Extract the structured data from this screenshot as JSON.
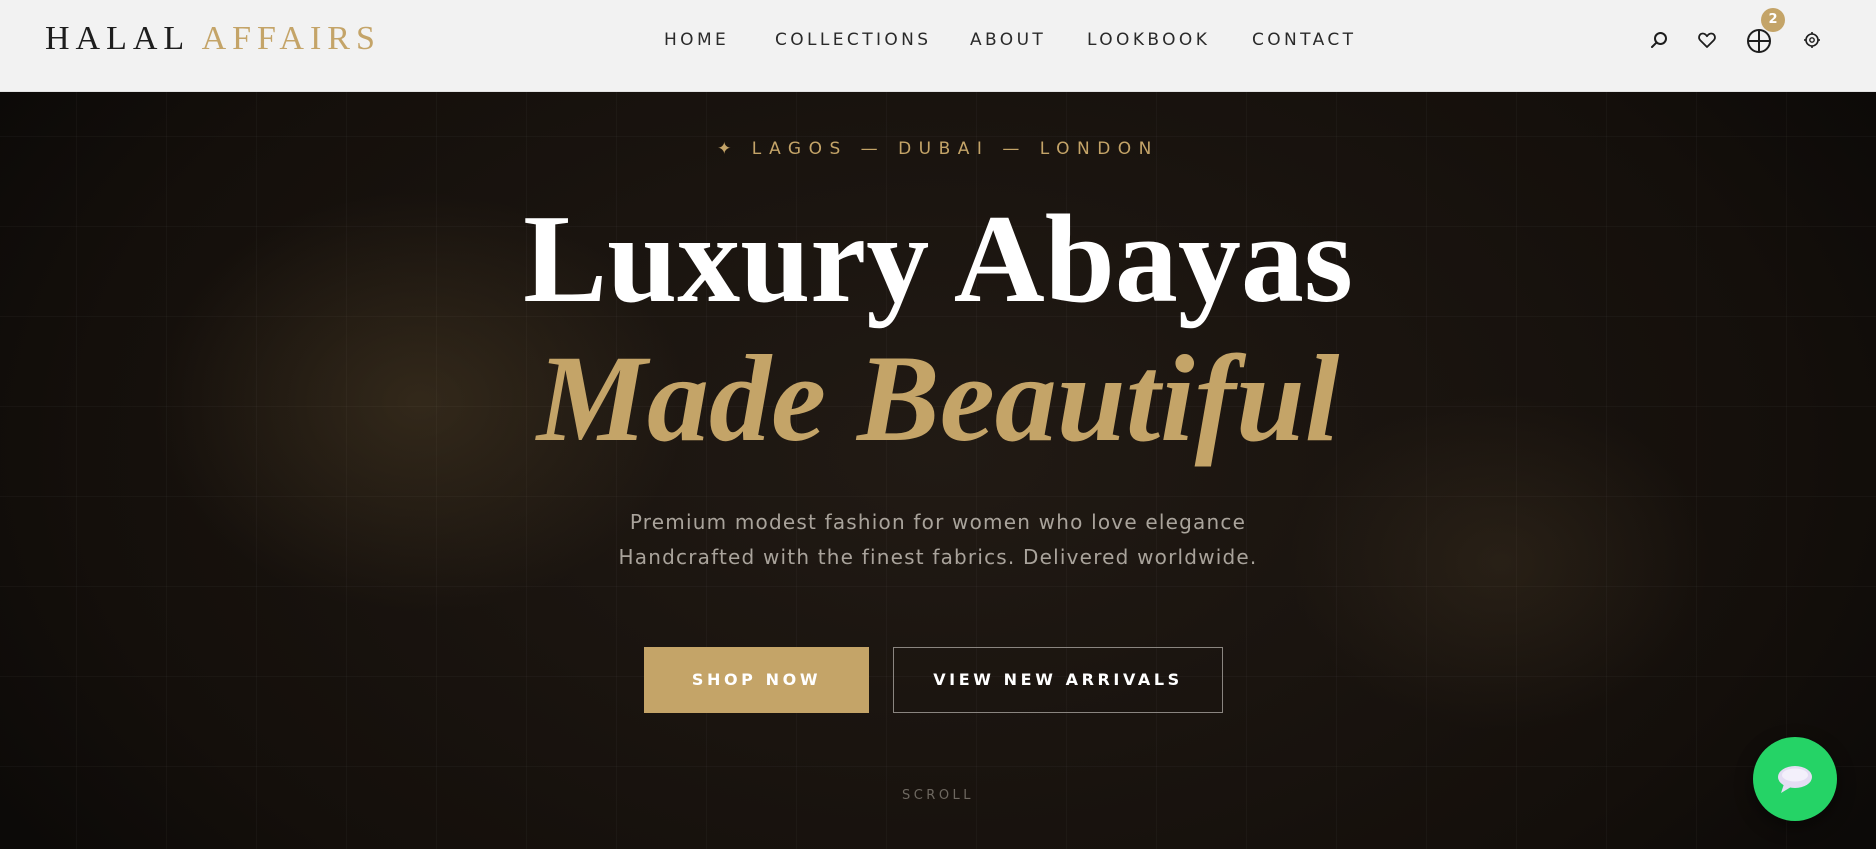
{
  "brand": {
    "name_primary": "HALAL",
    "name_accent": "AFFAIRS"
  },
  "nav": {
    "items": [
      {
        "label": "HOME"
      },
      {
        "label": "COLLECTIONS"
      },
      {
        "label": "ABOUT"
      },
      {
        "label": "LOOKBOOK"
      },
      {
        "label": "CONTACT"
      }
    ]
  },
  "header_icons": {
    "search": "search-icon",
    "wishlist": "heart-icon",
    "cart": "cart-icon",
    "cart_count": "2",
    "account": "user-icon"
  },
  "hero": {
    "tagline": "✦ LAGOS — DUBAI — LONDON",
    "headline_line1": "Luxury Abayas",
    "headline_line2": "Made Beautiful",
    "subtitle_line1": "Premium modest fashion for women who love elegance",
    "subtitle_line2": "Handcrafted with the finest fabrics. Delivered worldwide.",
    "primary_cta": "SHOP NOW",
    "secondary_cta": "VIEW NEW ARRIVALS",
    "scroll_hint": "SCROLL"
  },
  "chat_widget": {
    "icon": "chat-bubble-icon"
  },
  "colors": {
    "accent_gold": "#c4a468",
    "hero_background": "#15110d",
    "header_background": "#f2f2f2",
    "chat_green": "#25d366"
  }
}
